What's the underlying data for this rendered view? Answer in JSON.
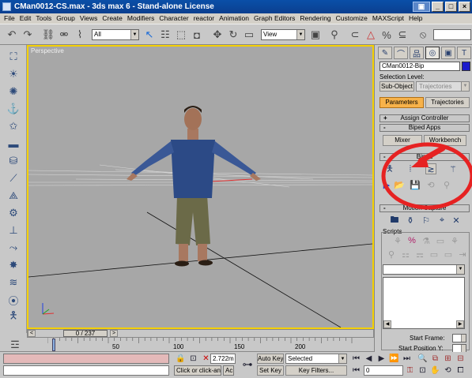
{
  "window": {
    "title": "CMan0012-CS.max - 3ds max 6 - Stand-alone License",
    "buttons": [
      "_",
      "□",
      "×"
    ]
  },
  "menu": [
    "File",
    "Edit",
    "Tools",
    "Group",
    "Views",
    "Create",
    "Modifiers",
    "Character",
    "reactor",
    "Animation",
    "Graph Editors",
    "Rendering",
    "Customize",
    "MAXScript",
    "Help"
  ],
  "toolbar": {
    "selection_filter": "All",
    "ref_coord": "View"
  },
  "viewport": {
    "label": "Perspective",
    "border_color": "#f4d000",
    "background": "#a7a7a7"
  },
  "timeline": {
    "frame_readout": "0 / 237",
    "prev": "<",
    "next": ">",
    "ticks": [
      "50",
      "100",
      "150",
      "200"
    ]
  },
  "status": {
    "coord_value": "2.722m",
    "prompt": "Click or click-and",
    "prompt2": "Ac",
    "auto_key": "Auto Key",
    "set_key": "Set Key",
    "key_mode": "Selected",
    "key_filters": "Key Filters...",
    "frame": "0"
  },
  "command_panel": {
    "object_name": "CMan0012-Bip",
    "object_color": "#1a1acc",
    "selection_level_label": "Selection Level:",
    "sub_object": "Sub-Object",
    "trajectories_select": "Trajectories",
    "tab_parameters": "Parameters",
    "tab_trajectories": "Trajectories",
    "rollout_assign": "Assign Controller",
    "rollout_biped_apps": "Biped Apps",
    "btn_mixer": "Mixer",
    "btn_workbench": "Workbench",
    "rollout_biped": "Biped",
    "rollout_motion": "Motion Capture",
    "scripts_label": "Scripts",
    "start_frame_label": "Start Frame:",
    "start_position_label": "Start Position Y:"
  }
}
